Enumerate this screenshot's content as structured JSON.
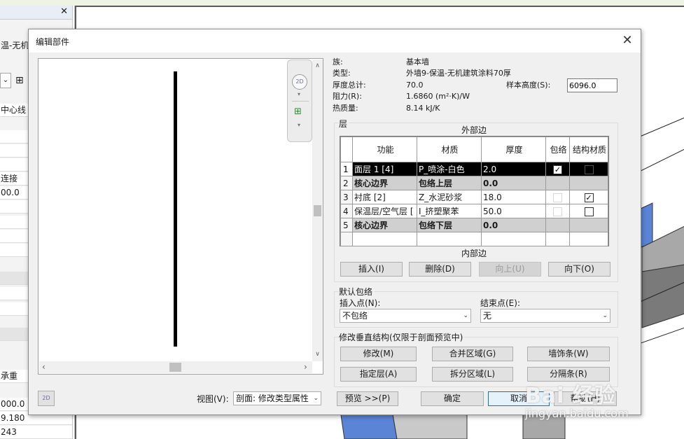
{
  "background_app": {
    "left_panel": {
      "title_fragment": "温-无机建",
      "close_glyph": "✕",
      "rows": [
        "中心线",
        "",
        "",
        "",
        "连接",
        "00.0",
        "",
        "",
        "",
        "",
        "",
        "",
        "",
        "",
        "承重",
        "000.0",
        "9.180",
        "243"
      ]
    }
  },
  "dialog": {
    "title": "编辑部件",
    "close_glyph": "✕",
    "properties": {
      "family_label": "族:",
      "family_value": "基本墙",
      "type_label": "类型:",
      "type_value": "外墙9-保温-无机建筑涂料70厚",
      "thickness_label": "厚度总计:",
      "thickness_value": "70.0",
      "sample_height_label": "样本高度(S):",
      "sample_height_value": "6096.0",
      "resistance_label": "阻力(R):",
      "resistance_value": "1.6860 (m²·K)/W",
      "thermal_label": "热质量:",
      "thermal_value": "8.14 kJ/K"
    },
    "layers": {
      "group_label": "层",
      "exterior_label": "外部边",
      "interior_label": "内部边",
      "columns": [
        "功能",
        "材质",
        "厚度",
        "包络",
        "结构材质"
      ],
      "rows": [
        {
          "num": "1",
          "function": "面层 1 [4]",
          "material": "P_喷涂-白色",
          "thickness": "2.0",
          "wrap": "☑",
          "structural": "■",
          "style": "sel"
        },
        {
          "num": "2",
          "function": "核心边界",
          "material": "包络上层",
          "thickness": "0.0",
          "wrap": "",
          "structural": "",
          "style": "core"
        },
        {
          "num": "3",
          "function": "衬底 [2]",
          "material": "Z_水泥砂浆",
          "thickness": "18.0",
          "wrap": "☐",
          "structural": "☑",
          "style": ""
        },
        {
          "num": "4",
          "function": "保温层/空气层 [",
          "material": "I_挤塑聚苯",
          "thickness": "50.0",
          "wrap": "☐",
          "structural": "☐",
          "style": ""
        },
        {
          "num": "5",
          "function": "核心边界",
          "material": "包络下层",
          "thickness": "0.0",
          "wrap": "",
          "structural": "",
          "style": "core"
        }
      ],
      "buttons": {
        "insert": "插入(I)",
        "delete": "删除(D)",
        "up": "向上(U)",
        "down": "向下(O)"
      }
    },
    "default_wrapping": {
      "group_label": "默认包络",
      "insert_label": "插入点(N):",
      "insert_value": "不包络",
      "end_label": "结束点(E):",
      "end_value": "无"
    },
    "modify_vertical": {
      "group_label": "修改垂直结构(仅限于剖面预览中)",
      "buttons": {
        "modify": "修改(M)",
        "merge": "合并区域(G)",
        "sweeps": "墙饰条(W)",
        "assign": "指定层(A)",
        "split": "拆分区域(L)",
        "reveals": "分隔条(R)"
      }
    },
    "footer": {
      "view_label": "视图(V):",
      "view_value": "剖面: 修改类型属性",
      "preview_button": "预览 >>(P)",
      "ok_button": "确定",
      "cancel_button": "取消",
      "help_button": "帮助(H)"
    }
  },
  "watermark": {
    "line1": "Bai 经验",
    "line2": "jingyan.baidu.com"
  }
}
